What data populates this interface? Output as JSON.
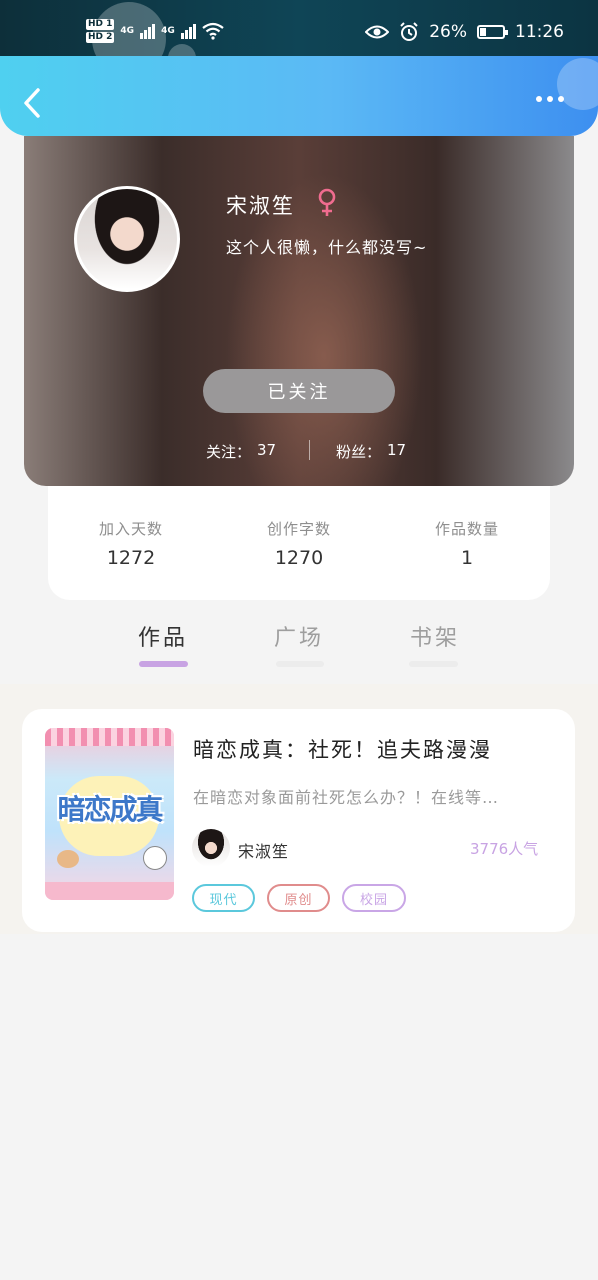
{
  "status_bar": {
    "hd1": "HD 1",
    "hd2": "HD 2",
    "net1": "4G",
    "net2": "4G",
    "battery": "26%",
    "battery_level": 0.26,
    "time": "11:26"
  },
  "header": {
    "back_icon": "chevron-left-icon",
    "more_icon": "more-dots-icon"
  },
  "profile": {
    "name": "宋淑笙",
    "gender_icon": "female-icon",
    "bio": "这个人很懒，什么都没写~",
    "follow_button": "已关注",
    "following_label": "关注：",
    "following_count": "37",
    "fans_label": "粉丝：",
    "fans_count": "17"
  },
  "stats": [
    {
      "label": "加入天数",
      "value": "1272"
    },
    {
      "label": "创作字数",
      "value": "1270"
    },
    {
      "label": "作品数量",
      "value": "1"
    }
  ],
  "tabs": [
    {
      "label": "作品",
      "active": true
    },
    {
      "label": "广场",
      "active": false
    },
    {
      "label": "书架",
      "active": false
    }
  ],
  "colors": {
    "accent_purple": "#c8a3e3",
    "tag_cyan": "#5bc8dc",
    "tag_red": "#e08c8c",
    "tag_purple": "#c9a6e6",
    "header_blue": "#5bb9f5"
  },
  "works": [
    {
      "cover_text": "暗恋成真",
      "title": "暗恋成真：社死！追夫路漫漫",
      "description": "在暗恋对象面前社死怎么办？！在线等…",
      "author": "宋淑笙",
      "popularity": "3776人气",
      "tags": [
        "现代",
        "原创",
        "校园"
      ]
    }
  ]
}
